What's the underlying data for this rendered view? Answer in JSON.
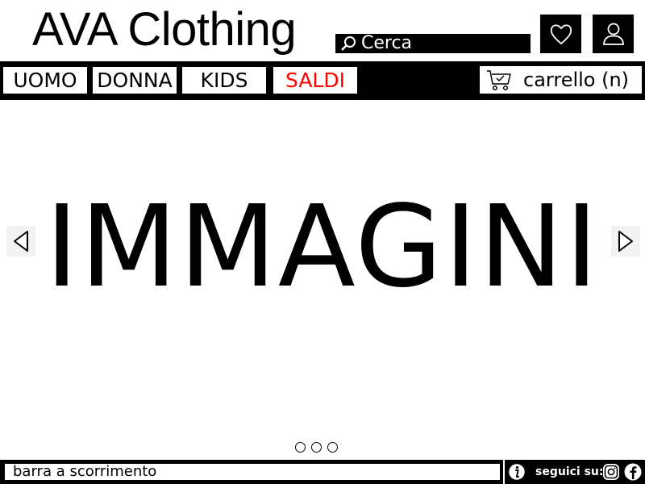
{
  "header": {
    "logo": "AVA Clothing",
    "search_label": "Cerca",
    "icons": [
      "search-icon",
      "heart-icon",
      "user-icon"
    ]
  },
  "nav": {
    "items": [
      {
        "label": "UOMO",
        "color": "#000000"
      },
      {
        "label": "DONNA",
        "color": "#000000"
      },
      {
        "label": "KIDS",
        "color": "#000000"
      },
      {
        "label": "SALDI",
        "color": "#ff0000"
      }
    ],
    "cart_label": "carrello (n)",
    "cart_icon": "cart-icon"
  },
  "hero": {
    "text": "IMMAGINI",
    "left_arrow_icon": "triangle-left-icon",
    "right_arrow_icon": "triangle-right-icon",
    "slide_count": 3
  },
  "footer": {
    "scroll_label": "barra a scorrimento",
    "follow_label": "seguici su:",
    "icons": [
      "info-icon",
      "instagram-icon",
      "facebook-icon"
    ]
  },
  "colors": {
    "bar_background": "#000000",
    "accent_sale": "#ff0000"
  }
}
